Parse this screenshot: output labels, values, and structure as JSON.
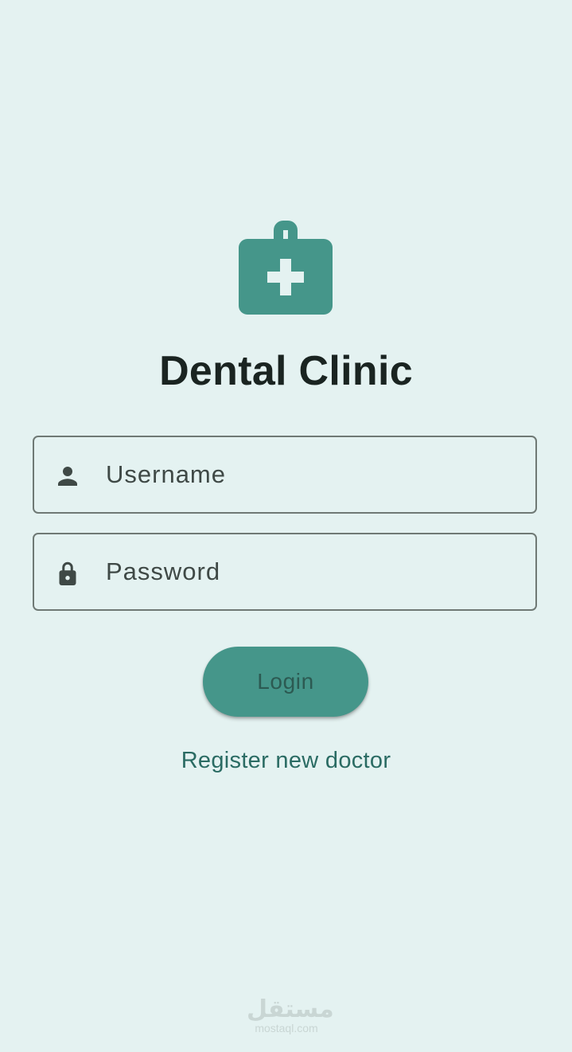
{
  "app": {
    "title": "Dental Clinic",
    "logo_icon": "medical-kit-icon"
  },
  "form": {
    "username": {
      "placeholder": "Username",
      "value": "",
      "icon": "person-icon"
    },
    "password": {
      "placeholder": "Password",
      "value": "",
      "icon": "lock-icon"
    },
    "login_label": "Login",
    "register_label": "Register new doctor"
  },
  "watermark": {
    "arabic": "مستقل",
    "latin": "mostaql.com"
  },
  "colors": {
    "background": "#e4f2f1",
    "accent": "#45968a",
    "title": "#1a2421",
    "link": "#2a6b63",
    "field_border": "#6f7975",
    "icon": "#3f4946"
  }
}
